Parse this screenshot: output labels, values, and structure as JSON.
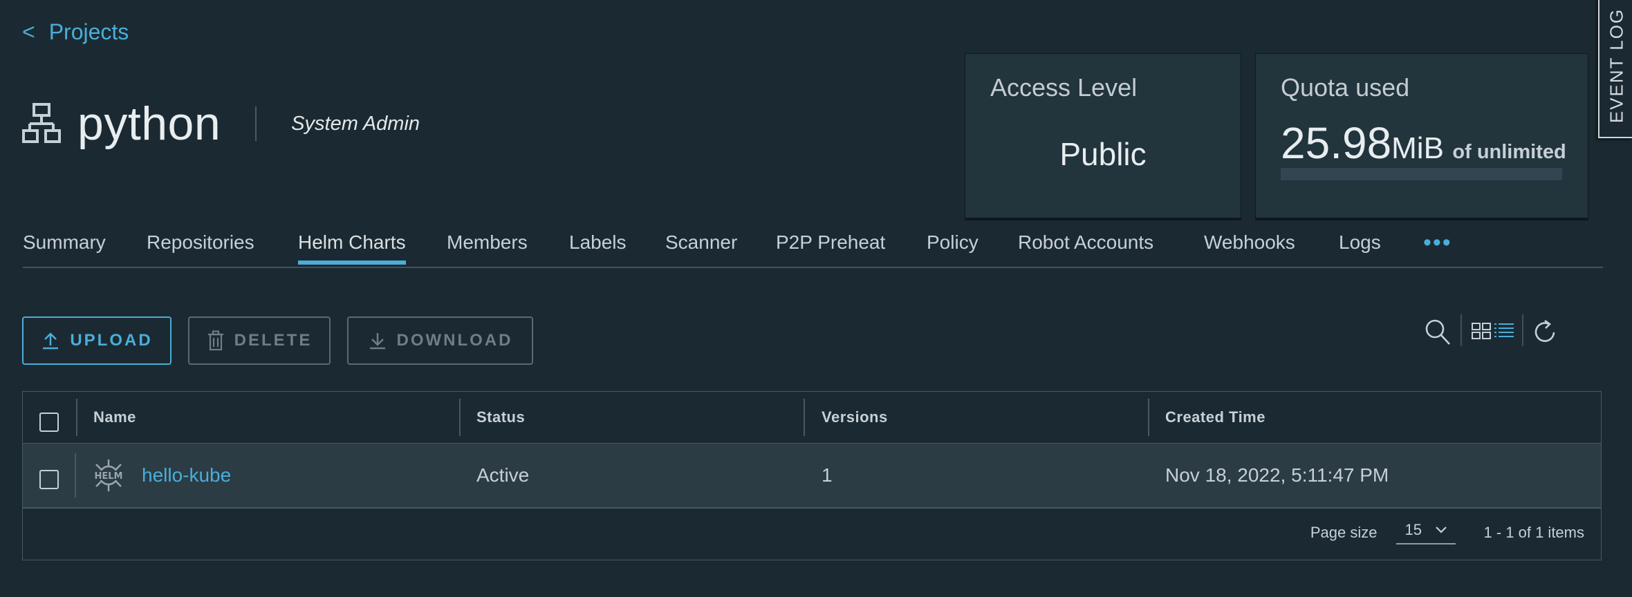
{
  "nav": {
    "back_icon": "<",
    "back_label": "Projects"
  },
  "project": {
    "name": "python",
    "role": "System Admin",
    "icon": "project-tree-icon"
  },
  "access_card": {
    "heading": "Access Level",
    "value": "Public"
  },
  "quota_card": {
    "heading": "Quota used",
    "used_number": "25.98",
    "used_unit": "MiB",
    "of_text": "of unlimited",
    "fill_fraction": 0
  },
  "event_log": {
    "label": "EVENT LOG"
  },
  "tabs": [
    {
      "label": "Summary"
    },
    {
      "label": "Repositories"
    },
    {
      "label": "Helm Charts",
      "active": true
    },
    {
      "label": "Members"
    },
    {
      "label": "Labels"
    },
    {
      "label": "Scanner"
    },
    {
      "label": "P2P Preheat"
    },
    {
      "label": "Policy"
    },
    {
      "label": "Robot Accounts"
    },
    {
      "label": "Webhooks"
    },
    {
      "label": "Logs"
    }
  ],
  "tabs_more": "•••",
  "toolbar": {
    "upload_label": "UPLOAD",
    "delete_label": "DELETE",
    "download_label": "DOWNLOAD"
  },
  "table": {
    "columns": [
      "Name",
      "Status",
      "Versions",
      "Created Time"
    ],
    "rows": [
      {
        "name": "hello-kube",
        "status": "Active",
        "versions": "1",
        "created": "Nov 18, 2022, 5:11:47 PM",
        "icon_text": "HELM"
      }
    ],
    "footer": {
      "page_size_label": "Page size",
      "page_size_value": "15",
      "pager_text": "1 - 1 of 1 items"
    }
  },
  "colors": {
    "background": "#1b2a32",
    "accent": "#4aaed9",
    "card": "#22343c",
    "row_highlight": "#2b3c45"
  }
}
